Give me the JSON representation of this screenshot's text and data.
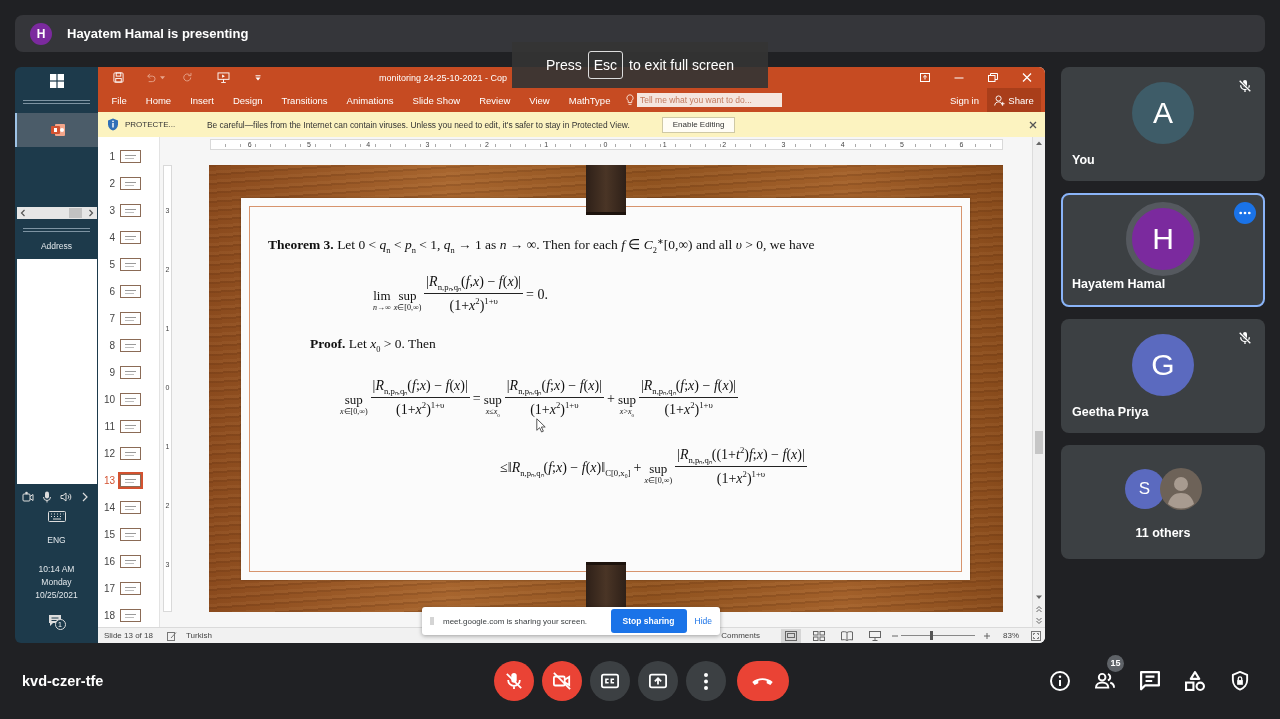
{
  "presenting_bar": {
    "avatar": "H",
    "text": "Hayatem Hamal is presenting"
  },
  "fullscreen_hint": {
    "before": "Press",
    "key": "Esc",
    "after": "to exit full screen"
  },
  "shared_screen": {
    "windows_panel": {
      "apps": [
        {
          "selected": true
        }
      ],
      "address_label": "Address",
      "language": "ENG",
      "time": "10:14 AM",
      "day": "Monday",
      "date": "10/25/2021",
      "notification_count": "1"
    },
    "powerpoint": {
      "title": "monitoring 24-25-10-2021 - Cop",
      "ribbon_tabs": [
        "File",
        "Home",
        "Insert",
        "Design",
        "Transitions",
        "Animations",
        "Slide Show",
        "Review",
        "View",
        "MathType"
      ],
      "search": {
        "placeholder": "Tell me what you want to do..."
      },
      "sign_in": "Sign in",
      "share": "Share",
      "protected_view": {
        "label": "PROTECTE...",
        "message": "Be careful—files from the Internet can contain viruses. Unless you need to edit, it's safer to stay in Protected View.",
        "button": "Enable Editing"
      },
      "slides": [
        {
          "number": "1",
          "selected": false
        },
        {
          "number": "2",
          "selected": false
        },
        {
          "number": "3",
          "selected": false
        },
        {
          "number": "4",
          "selected": false
        },
        {
          "number": "5",
          "selected": false
        },
        {
          "number": "6",
          "selected": false
        },
        {
          "number": "7",
          "selected": false
        },
        {
          "number": "8",
          "selected": false
        },
        {
          "number": "9",
          "selected": false
        },
        {
          "number": "10",
          "selected": false
        },
        {
          "number": "11",
          "selected": false
        },
        {
          "number": "12",
          "selected": false
        },
        {
          "number": "13",
          "selected": true
        },
        {
          "number": "14",
          "selected": false
        },
        {
          "number": "15",
          "selected": false
        },
        {
          "number": "16",
          "selected": false
        },
        {
          "number": "17",
          "selected": false
        },
        {
          "number": "18",
          "selected": false
        }
      ],
      "horizontal_ruler": [
        "6",
        "5",
        "4",
        "3",
        "2",
        "1",
        "0",
        "1",
        "2",
        "3",
        "4",
        "5",
        "6"
      ],
      "vertical_ruler": [
        "3",
        "2",
        "1",
        "0",
        "1",
        "2",
        "3"
      ],
      "slide": {
        "blocks": [
          {
            "kind": "paragraph",
            "text": "**Theorem 3.** Let 0 < *q*$_{n}$ < *p*$_{n}$ < 1, *q*$_{n}$ → 1 as *n* → ∞. Then for each *f* ∈ *C*$_{2}$$^{∗}$[0,∞) and all *υ* > 0, we have"
          },
          {
            "kind": "formula",
            "parts": [
              {
                "kind": "operator",
                "label": "lim",
                "under": "*n*→∞"
              },
              {
                "kind": "operator",
                "label": "sup",
                "under": "*x*∈[0,∞)"
              },
              {
                "kind": "fraction",
                "numerator": "|*R*$_{n,pₙ,qₙ}$(*f*,*x*) − *f*(*x*)|",
                "denominator": "(1+*x*$^{2}$)$^{1+υ}$"
              },
              {
                "kind": "text",
                "text": "= 0."
              }
            ]
          },
          {
            "kind": "paragraph",
            "text": "**Proof.** Let *x*$_{0}$ > 0. Then"
          },
          {
            "kind": "formula",
            "parts": [
              {
                "kind": "operator",
                "label": "sup",
                "under": "*x*∈[0,∞)"
              },
              {
                "kind": "fraction",
                "numerator": "|*R*$_{n,pₙ,qₙ}$(*f*;*x*) − *f*(*x*)|",
                "denominator": "(1+*x*$^{2}$)$^{1+υ}$"
              },
              {
                "kind": "text",
                "text": "="
              },
              {
                "kind": "operator",
                "label": "sup",
                "under": "*x*≤*x*$_{0}$"
              },
              {
                "kind": "fraction",
                "numerator": "|*R*$_{n,pₙ,qₙ}$(*f*;*x*) − *f*(*x*)|",
                "denominator": "(1+*x*$^{2}$)$^{1+υ}$"
              },
              {
                "kind": "text",
                "text": "+"
              },
              {
                "kind": "operator",
                "label": "sup",
                "under": "*x*>*x*$_{0}$"
              },
              {
                "kind": "fraction",
                "numerator": "|*R*$_{n,pₙ,qₙ}$(*f*;*x*) − *f*(*x*)|",
                "denominator": "(1+*x*$^{2}$)$^{1+υ}$"
              }
            ]
          },
          {
            "kind": "formula",
            "parts": [
              {
                "kind": "text",
                "text": "≤‖*R*$_{n,pₙ,qₙ}$(*f*;*x*) − *f*(*x*)‖$_{C[0,x₀]}$"
              },
              {
                "kind": "text",
                "text": "+"
              },
              {
                "kind": "operator",
                "label": "sup",
                "under": "*x*∈[0,∞)"
              },
              {
                "kind": "fraction",
                "numerator": "|*R*$_{n,pₙ,qₙ}$((1+*t*$^{2}$)*f*;*x*) − *f*(*x*)|",
                "denominator": "(1+*x*$^{2}$)$^{1+υ}$"
              }
            ]
          }
        ]
      },
      "status_bar": {
        "slide_info": "Slide 13 of 18",
        "language": "Turkish",
        "comments": "Comments",
        "view_buttons": [
          {
            "kind": "normal",
            "selected": true
          },
          {
            "kind": "sorter",
            "selected": false
          },
          {
            "kind": "reading",
            "selected": false
          },
          {
            "kind": "slideshow",
            "selected": false
          }
        ],
        "zoom": {
          "level": 0.4,
          "text": "83%"
        }
      }
    },
    "share_notice": {
      "message": "meet.google.com is sharing your screen.",
      "stop_button": "Stop sharing",
      "hide_link": "Hide"
    }
  },
  "participants": [
    {
      "kind": "person",
      "name": "You",
      "initial": "A",
      "color": "#3e5c68",
      "muted": true,
      "selected": false
    },
    {
      "kind": "person",
      "name": "Hayatem Hamal",
      "initial": "H",
      "color": "#7b2a9e",
      "muted": false,
      "selected": true
    },
    {
      "kind": "person",
      "name": "Geetha Priya",
      "initial": "G",
      "color": "#5b6abf",
      "muted": true,
      "selected": false
    },
    {
      "kind": "group",
      "name": "11 others",
      "initial": "S",
      "color": "#5b6abf",
      "muted": false,
      "selected": false
    }
  ],
  "meeting_code": "kvd-czer-tfe",
  "call_controls": [
    {
      "kind": "microphone",
      "on": false
    },
    {
      "kind": "camera",
      "on": false
    },
    {
      "kind": "captions",
      "on": false
    },
    {
      "kind": "present",
      "on": false
    },
    {
      "kind": "more"
    },
    {
      "kind": "leave"
    }
  ],
  "side_controls": [
    {
      "kind": "info"
    },
    {
      "kind": "people",
      "badge": "15"
    },
    {
      "kind": "chat"
    },
    {
      "kind": "activities"
    },
    {
      "kind": "security"
    }
  ]
}
